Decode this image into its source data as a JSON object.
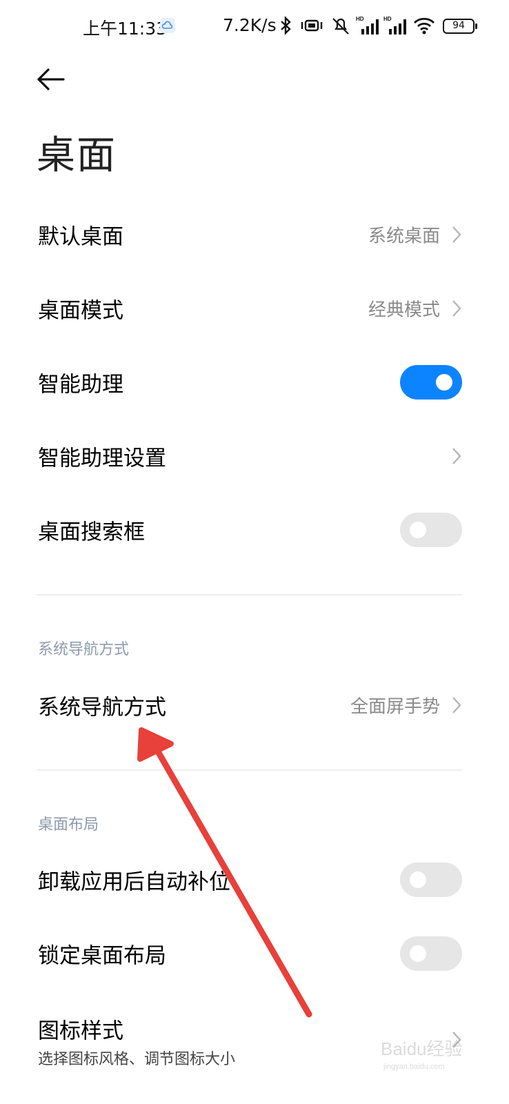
{
  "status_bar": {
    "time": "上午11:33",
    "network_speed": "7.2K/s",
    "battery": "94",
    "icons": [
      "cloud-icon",
      "bluetooth-icon",
      "vibrate-icon",
      "mute-icon",
      "hd-signal-icon",
      "hd-signal-icon",
      "wifi-icon",
      "battery-icon"
    ]
  },
  "header": {
    "title": "桌面"
  },
  "settings": {
    "default_launcher": {
      "label": "默认桌面",
      "value": "系统桌面"
    },
    "launcher_mode": {
      "label": "桌面模式",
      "value": "经典模式"
    },
    "smart_assistant": {
      "label": "智能助理",
      "enabled": true
    },
    "smart_assistant_settings": {
      "label": "智能助理设置"
    },
    "search_bar": {
      "label": "桌面搜索框",
      "enabled": false
    }
  },
  "nav_section": {
    "header": "系统导航方式",
    "nav_mode": {
      "label": "系统导航方式",
      "value": "全面屏手势"
    }
  },
  "layout_section": {
    "header": "桌面布局",
    "auto_fill": {
      "label": "卸载应用后自动补位",
      "enabled": false
    },
    "lock_layout": {
      "label": "锁定桌面布局",
      "enabled": false
    },
    "icon_style": {
      "label": "图标样式",
      "sublabel": "选择图标风格、调节图标大小"
    }
  },
  "annotation": {
    "arrow_color": "#e8403a"
  },
  "watermark": {
    "text": "Baidu经验",
    "url": "jingyan.baidu.com"
  },
  "colors": {
    "accent": "#0d84ff",
    "section_header": "#8e9aad"
  }
}
